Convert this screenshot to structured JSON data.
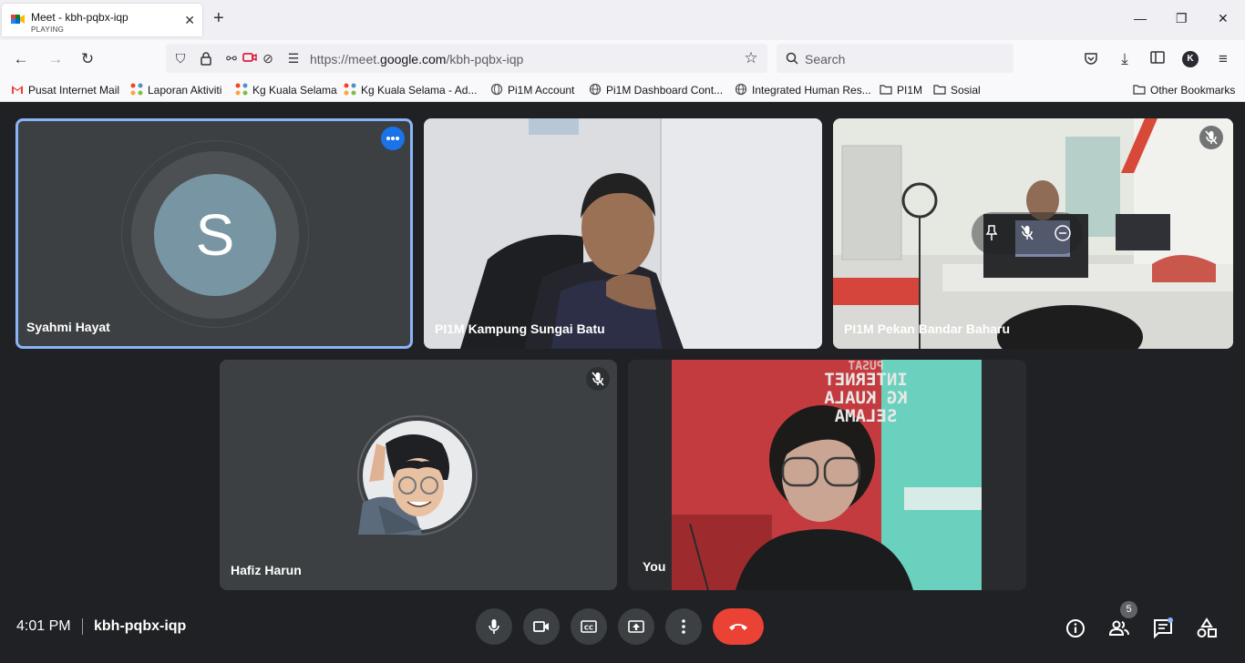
{
  "browser": {
    "tab": {
      "title": "Meet - kbh-pqbx-iqp",
      "status": "PLAYING"
    },
    "url": {
      "prefix": "https://meet.",
      "domain": "google.com",
      "path": "/kbh-pqbx-iqp"
    },
    "search_placeholder": "Search",
    "profile_initial": "K",
    "bookmarks": [
      "Pusat Internet Mail",
      "Laporan Aktiviti",
      "Kg Kuala Selama",
      "Kg Kuala Selama - Ad...",
      "Pi1M Account",
      "Pi1M Dashboard Cont...",
      "Integrated Human Res...",
      "PI1M",
      "Sosial"
    ],
    "other_bookmarks": "Other Bookmarks"
  },
  "meet": {
    "participants": [
      {
        "name": "Syahmi Hayat",
        "initial": "S"
      },
      {
        "name": "PI1M Kampung Sungai Batu"
      },
      {
        "name": "PI1M Pekan Bandar Baharu"
      },
      {
        "name": "Hafiz Harun"
      },
      {
        "name": "You"
      }
    ],
    "poster_text": [
      "PUSAT",
      "INTERNET",
      "KG KUALA",
      "SELAMA"
    ],
    "time": "4:01 PM",
    "meeting_code": "kbh-pqbx-iqp",
    "people_count": "5",
    "colors": {
      "accent": "#8ab4f8",
      "hangup": "#ea4335",
      "active_border": "#8ab4f8"
    }
  }
}
